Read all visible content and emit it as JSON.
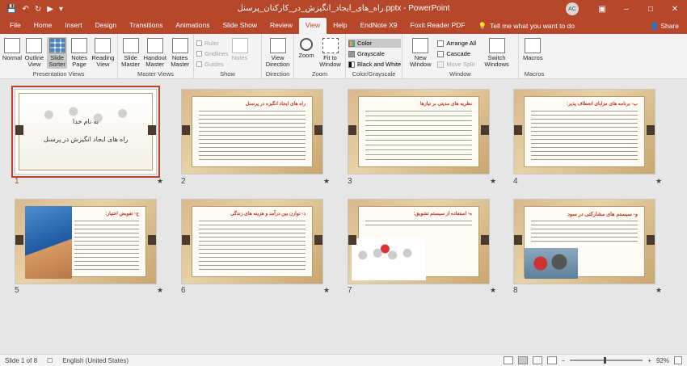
{
  "titlebar": {
    "title": "راه_های_ایجاد_انگیزش_در_کارکنان_پرسنل.pptx  -  PowerPoint",
    "avatar_initials": "AC",
    "qat_icons": [
      "save-icon",
      "undo-icon",
      "redo-icon",
      "slideshow-from-start-icon",
      "customize-qat-icon"
    ]
  },
  "tabs": [
    "File",
    "Home",
    "Insert",
    "Design",
    "Transitions",
    "Animations",
    "Slide Show",
    "Review",
    "View",
    "Help",
    "EndNote X9",
    "Foxit Reader PDF"
  ],
  "active_tab": "View",
  "tell_me": "Tell me what you want to do",
  "share": "Share",
  "ribbon": {
    "presentation_views": {
      "label": "Presentation Views",
      "buttons": [
        "Normal",
        "Outline View",
        "Slide Sorter",
        "Notes Page",
        "Reading View"
      ],
      "selected": "Slide Sorter"
    },
    "master_views": {
      "label": "Master Views",
      "buttons": [
        "Slide Master",
        "Handout Master",
        "Notes Master"
      ]
    },
    "show": {
      "label": "Show",
      "items": [
        "Ruler",
        "Gridlines",
        "Guides"
      ],
      "notes": "Notes"
    },
    "direction": {
      "label": "Direction",
      "button": "View Direction"
    },
    "zoom": {
      "label": "Zoom",
      "buttons": [
        "Zoom",
        "Fit to Window"
      ]
    },
    "color_grayscale": {
      "label": "Color/Grayscale",
      "items": [
        "Color",
        "Grayscale",
        "Black and White"
      ],
      "selected": "Color"
    },
    "window": {
      "label": "Window",
      "new_window": "New Window",
      "small": [
        "Arrange All",
        "Cascade",
        "Move Split"
      ],
      "switch": "Switch Windows"
    },
    "macros": {
      "label": "Macros",
      "button": "Macros"
    }
  },
  "slides": [
    {
      "num": "1",
      "title_line1": "به نام خدا",
      "title_line2": "راه های ایجاد انگیزش در پرسنل"
    },
    {
      "num": "2",
      "heading": "راه های ایجاد انگیزه در پرسنل"
    },
    {
      "num": "3",
      "heading": "نظریه های مدیتی بر نیازها"
    },
    {
      "num": "4",
      "heading": "ب- برنامه های مزایای انعطاف پذیر:"
    },
    {
      "num": "5",
      "heading": "ج- تفویض اختیار:"
    },
    {
      "num": "6",
      "heading": "د- توازن بین درآمد و هزینه های زندگی"
    },
    {
      "num": "7",
      "heading": "ه- استفاده از سیستم تشویق:"
    },
    {
      "num": "8",
      "heading": "و- سیستم های مشارکتی در سود"
    }
  ],
  "status": {
    "slide_of": "Slide 1 of 8",
    "language": "English (United States)",
    "zoom": "92%"
  }
}
